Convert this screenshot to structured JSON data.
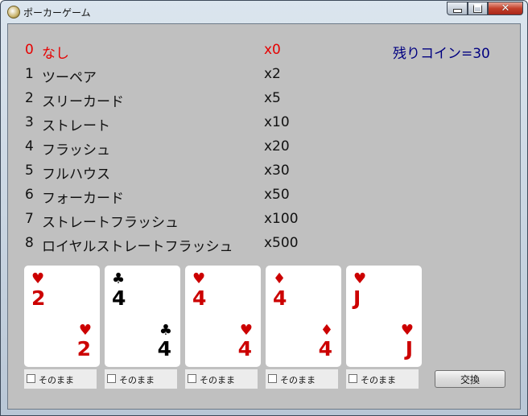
{
  "window": {
    "title": "ポーカーゲーム",
    "close_glyph": "✕"
  },
  "hands": [
    {
      "num": "0",
      "name": "なし",
      "mult": "x0",
      "current": true
    },
    {
      "num": "1",
      "name": "ツーペア",
      "mult": "x2",
      "current": false
    },
    {
      "num": "2",
      "name": "スリーカード",
      "mult": "x5",
      "current": false
    },
    {
      "num": "3",
      "name": "ストレート",
      "mult": "x10",
      "current": false
    },
    {
      "num": "4",
      "name": "フラッシュ",
      "mult": "x20",
      "current": false
    },
    {
      "num": "5",
      "name": "フルハウス",
      "mult": "x30",
      "current": false
    },
    {
      "num": "6",
      "name": "フォーカード",
      "mult": "x50",
      "current": false
    },
    {
      "num": "7",
      "name": "ストレートフラッシュ",
      "mult": "x100",
      "current": false
    },
    {
      "num": "8",
      "name": "ロイヤルストレートフラッシュ",
      "mult": "x500",
      "current": false
    }
  ],
  "coins": "残りコイン=30",
  "cards": [
    {
      "rank": "2",
      "suit": "♥",
      "suit_name": "heart",
      "color": "#cc0000"
    },
    {
      "rank": "4",
      "suit": "♣",
      "suit_name": "club",
      "color": "#000000"
    },
    {
      "rank": "4",
      "suit": "♥",
      "suit_name": "heart",
      "color": "#cc0000"
    },
    {
      "rank": "4",
      "suit": "♦",
      "suit_name": "diamond",
      "color": "#cc0000"
    },
    {
      "rank": "J",
      "suit": "♥",
      "suit_name": "heart",
      "color": "#cc0000"
    }
  ],
  "hold_label": "そのまま",
  "holds": [
    false,
    false,
    false,
    false,
    false
  ],
  "exchange_label": "交換",
  "colors": {
    "current_hand": "#e60000",
    "coins": "#000080",
    "client_bg": "#c0c0c0"
  }
}
